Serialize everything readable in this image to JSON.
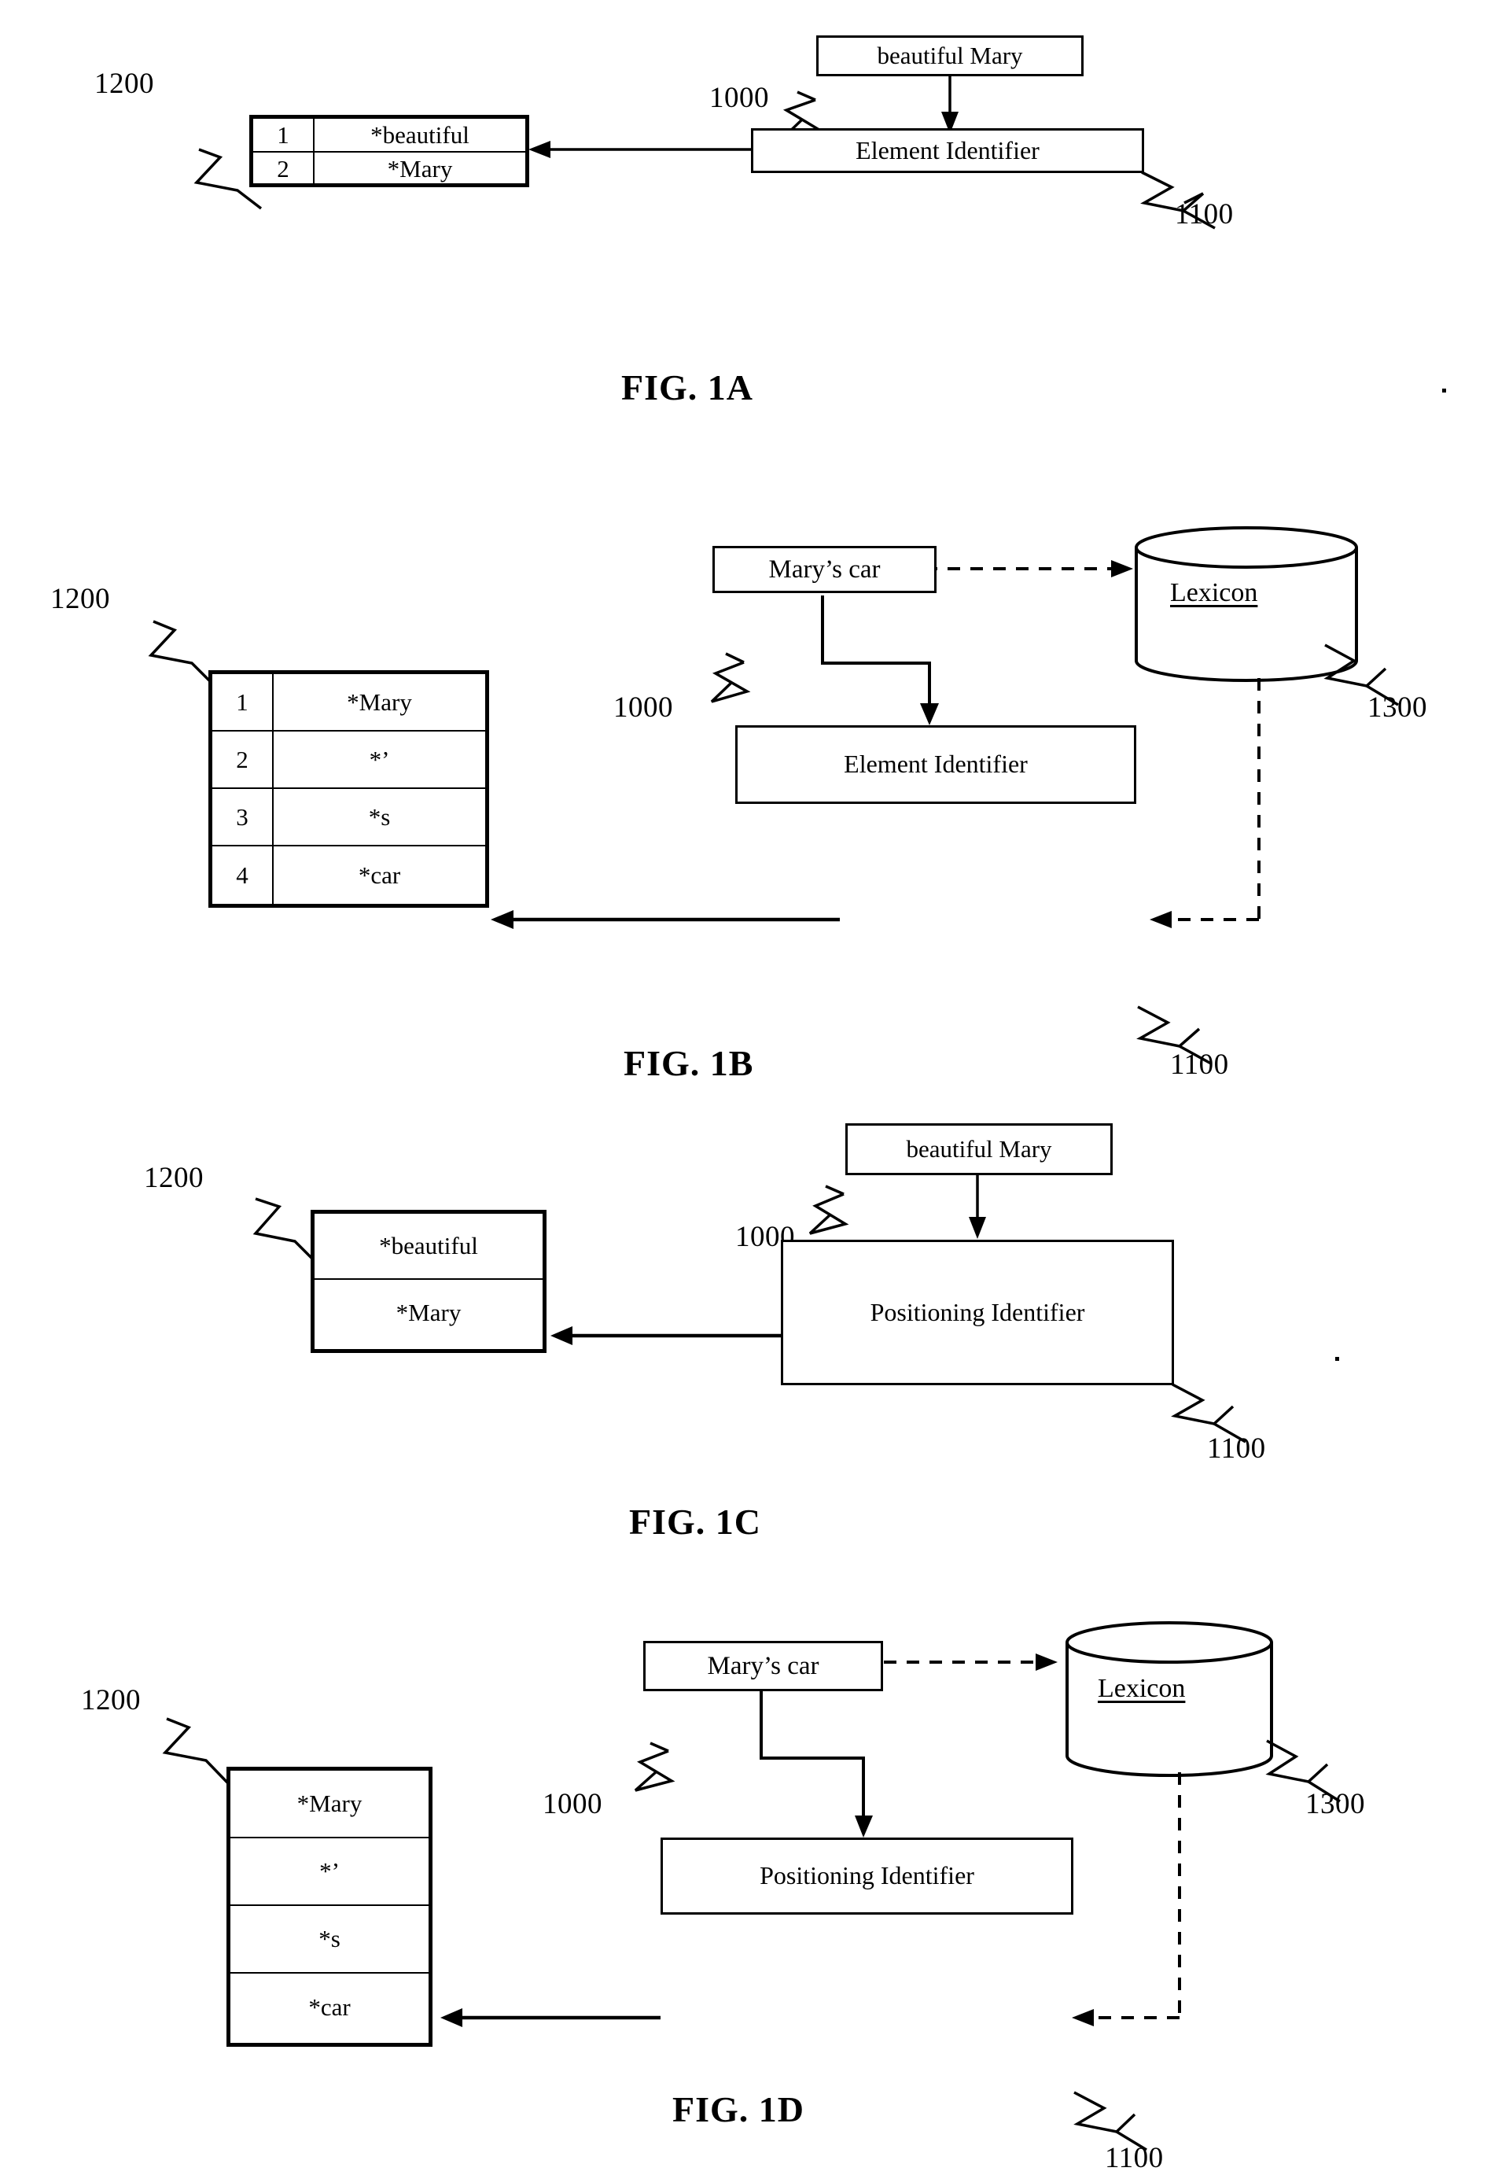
{
  "page": {
    "title": "Patent drawing sheet - FIG. 1A through FIG. 1D",
    "ink_color": "#000000",
    "background_color": "#ffffff"
  },
  "figures": [
    {
      "caption": "FIG. 1A",
      "input_box": {
        "label": "beautiful Mary",
        "ref": "1000"
      },
      "processor_box": {
        "label": "Element Identifier",
        "ref": "1100"
      },
      "element_list": {
        "ref": "1200",
        "has_index_column": true,
        "rows": [
          {
            "index": "1",
            "value": "*beautiful"
          },
          {
            "index": "2",
            "value": "*Mary"
          }
        ]
      },
      "lexicon": null
    },
    {
      "caption": "FIG. 1B",
      "input_box": {
        "label": "Mary’s car",
        "ref": "1000"
      },
      "processor_box": {
        "label": "Element Identifier",
        "ref": "1100"
      },
      "element_list": {
        "ref": "1200",
        "has_index_column": true,
        "rows": [
          {
            "index": "1",
            "value": "*Mary"
          },
          {
            "index": "2",
            "value": "*’"
          },
          {
            "index": "3",
            "value": "*s"
          },
          {
            "index": "4",
            "value": "*car"
          }
        ]
      },
      "lexicon": {
        "label": "Lexicon",
        "ref": "1300"
      }
    },
    {
      "caption": "FIG. 1C",
      "input_box": {
        "label": "beautiful Mary",
        "ref": "1000"
      },
      "processor_box": {
        "label": "Positioning Identifier",
        "ref": "1100"
      },
      "element_list": {
        "ref": "1200",
        "has_index_column": false,
        "rows": [
          {
            "index": "",
            "value": "*beautiful"
          },
          {
            "index": "",
            "value": "*Mary"
          }
        ]
      },
      "lexicon": null
    },
    {
      "caption": "FIG. 1D",
      "input_box": {
        "label": "Mary’s car",
        "ref": "1000"
      },
      "processor_box": {
        "label": "Positioning Identifier",
        "ref": "1100"
      },
      "element_list": {
        "ref": "1200",
        "has_index_column": false,
        "rows": [
          {
            "index": "",
            "value": "*Mary"
          },
          {
            "index": "",
            "value": "*’"
          },
          {
            "index": "",
            "value": "*s"
          },
          {
            "index": "",
            "value": "*car"
          }
        ]
      },
      "lexicon": {
        "label": "Lexicon",
        "ref": "1300"
      }
    }
  ]
}
